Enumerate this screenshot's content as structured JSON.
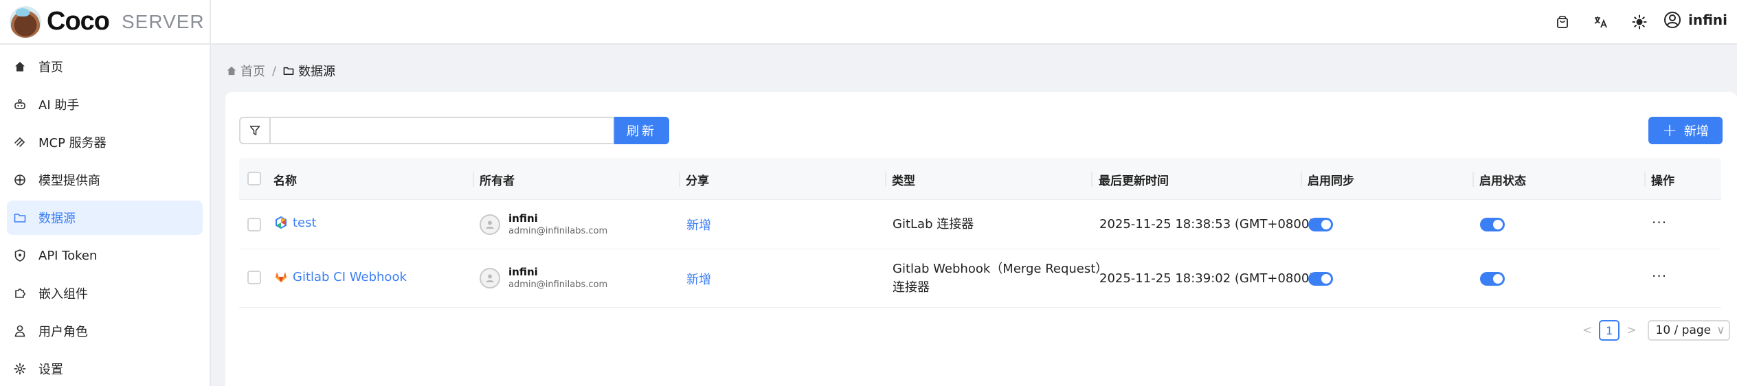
{
  "brand": {
    "name": "Coco",
    "sub": "SERVER"
  },
  "sidebar": {
    "items": [
      {
        "label": "首页",
        "icon": "home-icon"
      },
      {
        "label": "AI 助手",
        "icon": "robot-icon"
      },
      {
        "label": "MCP 服务器",
        "icon": "mcp-icon"
      },
      {
        "label": "模型提供商",
        "icon": "model-icon"
      },
      {
        "label": "数据源",
        "icon": "folder-icon",
        "active": true
      },
      {
        "label": "API Token",
        "icon": "shield-icon"
      },
      {
        "label": "嵌入组件",
        "icon": "puzzle-icon"
      },
      {
        "label": "用户角色",
        "icon": "user-icon"
      },
      {
        "label": "设置",
        "icon": "gear-icon"
      }
    ]
  },
  "header": {
    "user": "infini"
  },
  "breadcrumb": {
    "home": "首页",
    "sep": "/",
    "current": "数据源"
  },
  "toolbar": {
    "refresh": "刷新",
    "add": "新增",
    "search_value": ""
  },
  "table": {
    "headers": {
      "name": "名称",
      "owner": "所有者",
      "share": "分享",
      "type": "类型",
      "updated": "最后更新时间",
      "sync": "启用同步",
      "status": "启用状态",
      "actions": "操作"
    },
    "rows": [
      {
        "name": "test",
        "icon": "gitlab-connector-icon",
        "owner_name": "infini",
        "owner_email": "admin@infinilabs.com",
        "share": "新增",
        "type_line1": "GitLab 连接器",
        "type_line2": "",
        "updated": "2025-11-25 18:38:53 (GMT+0800)",
        "sync": true,
        "enabled": true,
        "more": "···"
      },
      {
        "name": "Gitlab CI Webhook",
        "icon": "gitlab-fox-icon",
        "owner_name": "infini",
        "owner_email": "admin@infinilabs.com",
        "share": "新增",
        "type_line1": "Gitlab Webhook（Merge Request）",
        "type_line2": "连接器",
        "updated": "2025-11-25 18:39:02 (GMT+0800)",
        "sync": true,
        "enabled": true,
        "more": "···"
      }
    ]
  },
  "pagination": {
    "current": "1",
    "prev": "<",
    "next": ">",
    "page_size": "10 / page",
    "chev": "∨"
  },
  "colors": {
    "accent": "#3b7ff5",
    "active_bg": "#e8f1ff"
  }
}
